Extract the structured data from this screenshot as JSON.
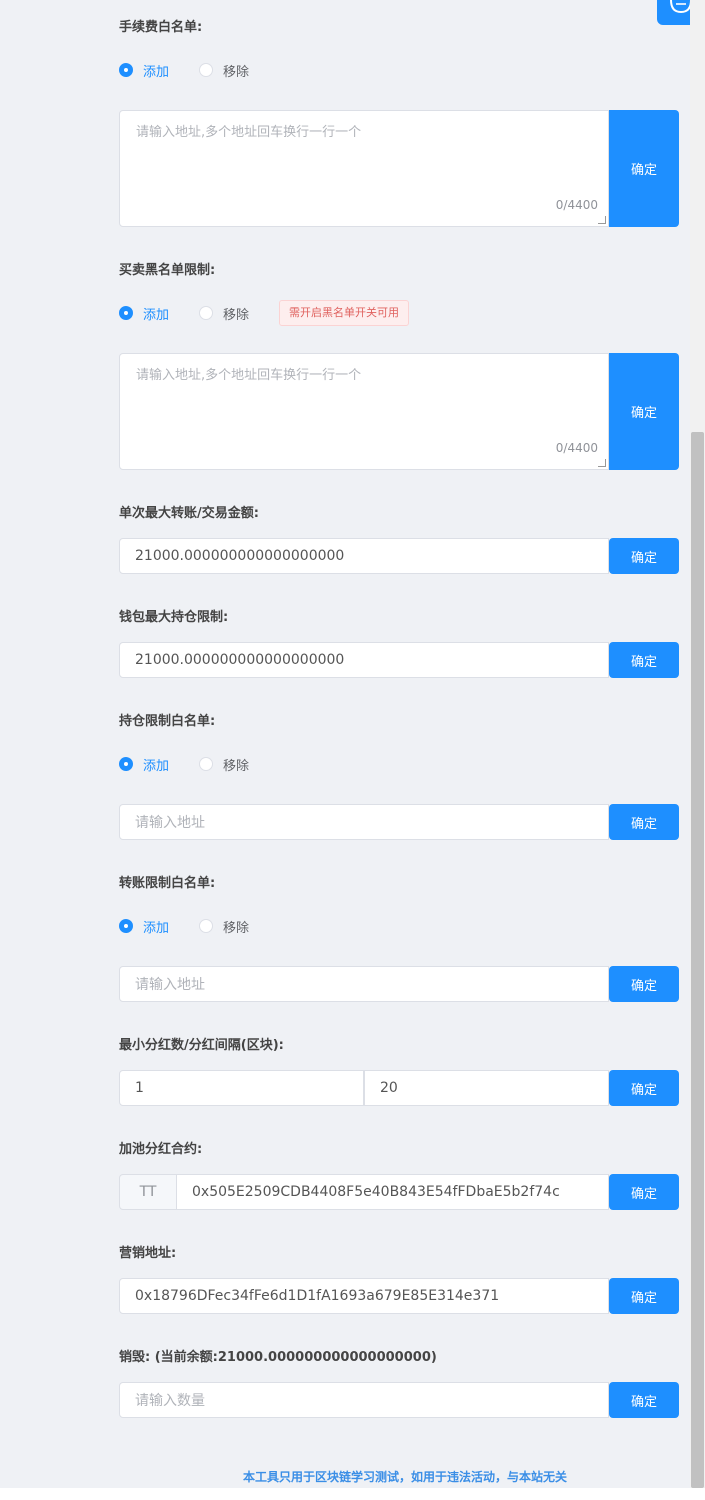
{
  "confirm_label": "确定",
  "radio_add": "添加",
  "radio_remove": "移除",
  "addr_multi_placeholder": "请输入地址,多个地址回车换行一行一个",
  "addr_placeholder": "请输入地址",
  "fee_whitelist": {
    "label": "手续费白名单:",
    "counter": "0/4400"
  },
  "trade_blacklist": {
    "label": "买卖黑名单限制:",
    "counter": "0/4400",
    "notice": "需开启黑名单开关可用"
  },
  "max_tx": {
    "label": "单次最大转账/交易金额:",
    "value": "21000.000000000000000000"
  },
  "max_wallet": {
    "label": "钱包最大持仓限制:",
    "value": "21000.000000000000000000"
  },
  "hold_whitelist": {
    "label": "持仓限制白名单:"
  },
  "transfer_whitelist": {
    "label": "转账限制白名单:"
  },
  "dividend": {
    "label": "最小分红数/分红间隔(区块):",
    "min_value": "1",
    "interval_value": "20"
  },
  "lp_dividend": {
    "label": "加池分红合约:",
    "prefix": "TT",
    "value": "0x505E2509CDB4408F5e40B843E54fFDbaE5b2f74c"
  },
  "marketing": {
    "label": "营销地址:",
    "value": "0x18796DFec34fFe6d1D1fA1693a679E85E314e371"
  },
  "burn": {
    "label_prefix": "销毁: (当前余额:",
    "balance": "21000.000000000000000000",
    "label_suffix": ")",
    "placeholder": "请输入数量"
  },
  "footer_text": "本工具只用于区块链学习测试，如用于违法活动，与本站无关",
  "colors": {
    "accent": "#1e8fff",
    "background": "#eff1f5",
    "warning_bg": "#fdeeee",
    "warning_text": "#e0625f"
  },
  "icons": {
    "chat": "chat-bubble-icon"
  }
}
